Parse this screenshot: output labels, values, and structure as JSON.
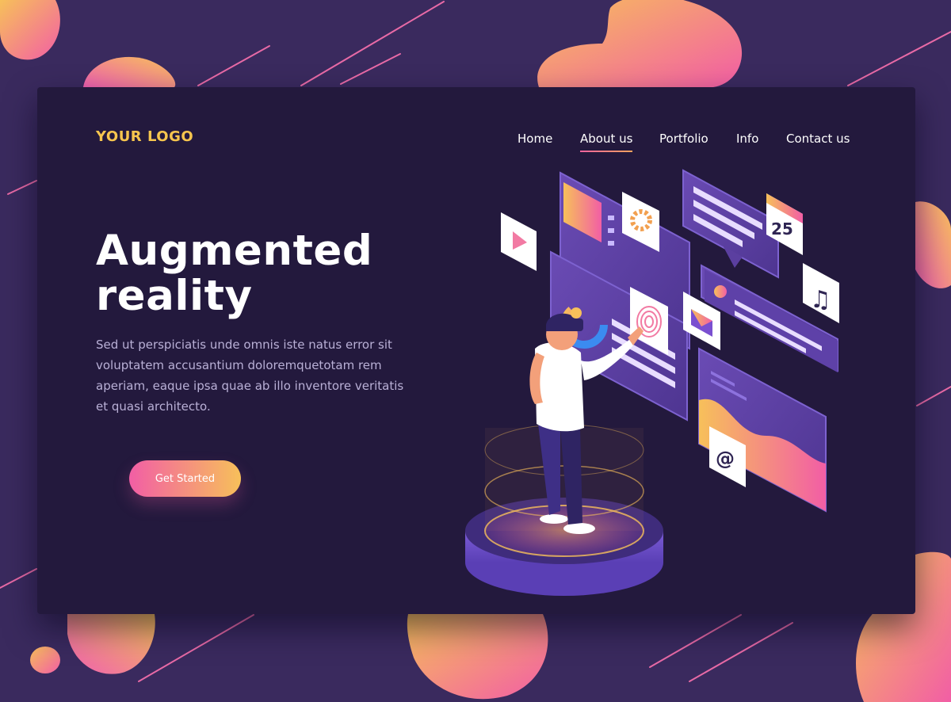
{
  "header": {
    "logo": "YOUR LOGO",
    "nav": [
      "Home",
      "About us",
      "Portfolio",
      "Info",
      "Contact us"
    ],
    "active_nav": "About us"
  },
  "hero": {
    "title_line1": "Augmented",
    "title_line2": "reality",
    "body_lines": [
      "Sed ut perspiciatis unde omnis iste natus error sit",
      "voluptatem accusantium doloremquetotam rem",
      "aperiam, eaque ipsa quae ab illo inventore veritatis",
      "et quasi architecto."
    ],
    "cta_label": "Get Started"
  },
  "illustration": {
    "calendar_day": "25",
    "email_symbol": "@",
    "music_symbol": "♫"
  },
  "colors": {
    "background": "#3a2a5e",
    "card": "#23193d",
    "logo": "#f6c54e",
    "accent_pink": "#f25ea5",
    "accent_orange": "#f7c05a",
    "panel_purple": "#5b3fa0"
  },
  "icons": [
    "play-icon",
    "gear-icon",
    "calendar-icon",
    "music-note-icon",
    "fingerprint-icon",
    "mail-icon",
    "user-icon",
    "at-sign-icon"
  ]
}
